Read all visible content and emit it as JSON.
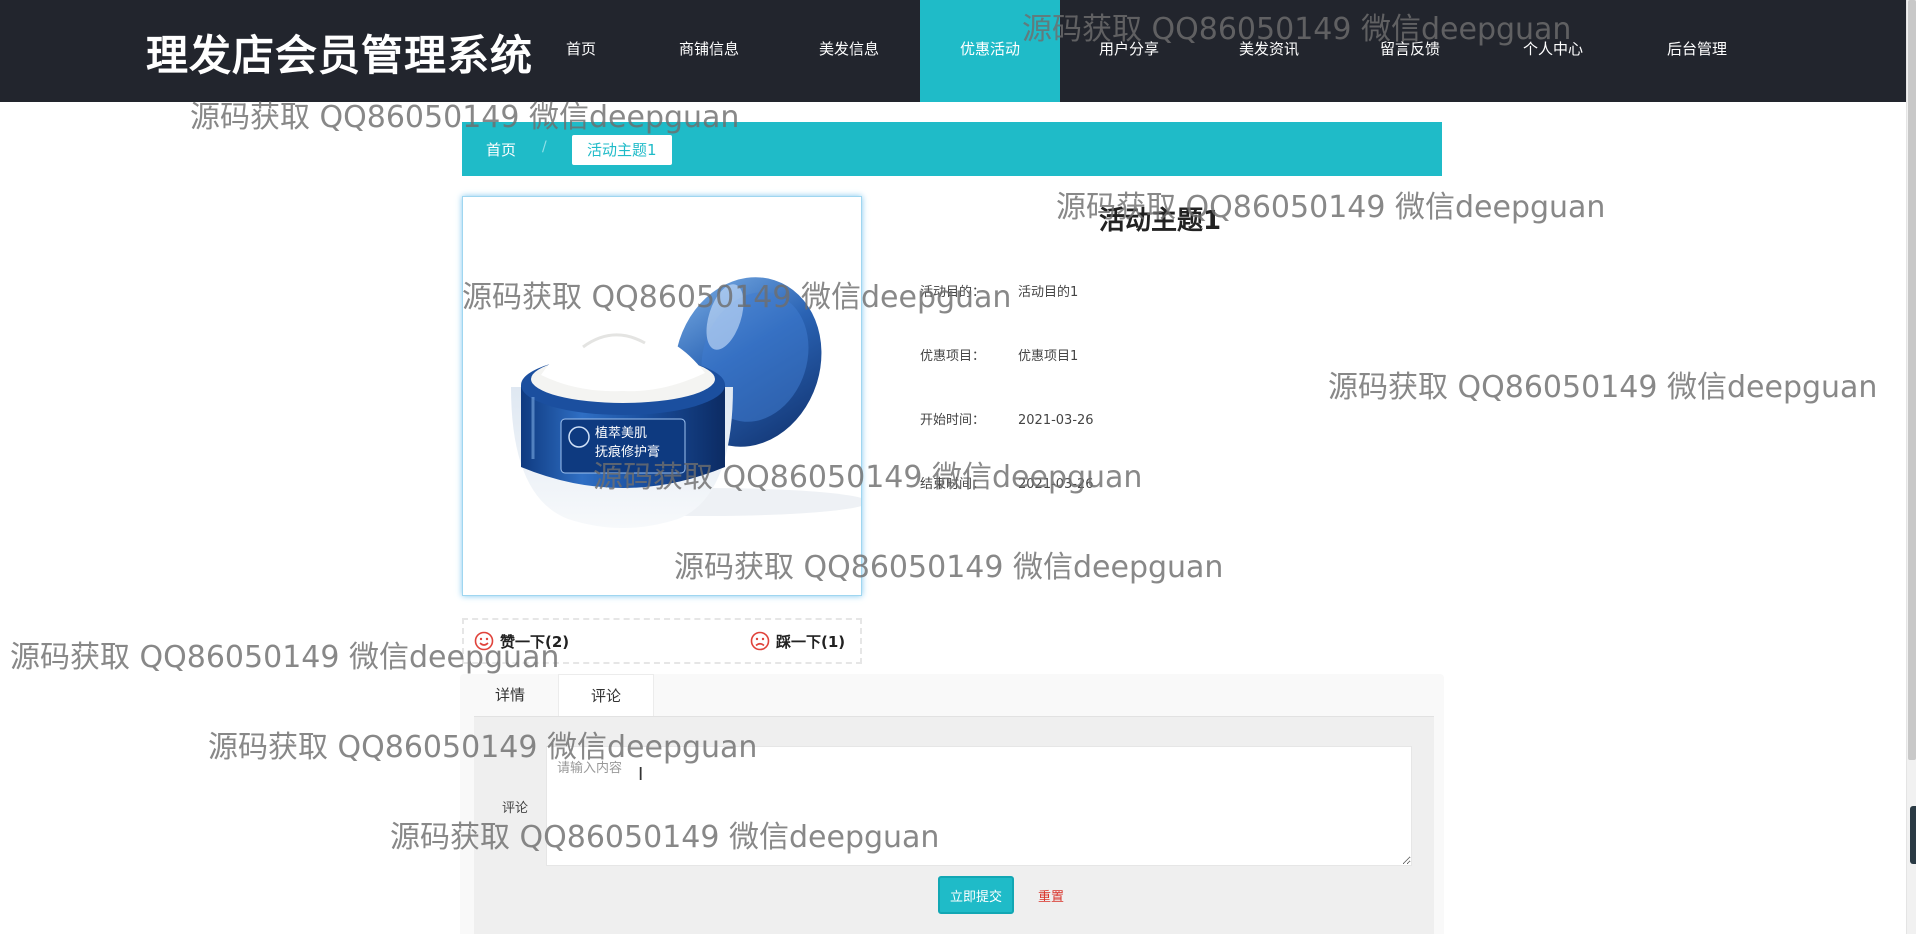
{
  "header": {
    "site_title": "理发店会员管理系统",
    "nav": [
      {
        "label": "首页"
      },
      {
        "label": "商铺信息"
      },
      {
        "label": "美发信息"
      },
      {
        "label": "优惠活动",
        "active": true
      },
      {
        "label": "用户分享"
      },
      {
        "label": "美发资讯"
      },
      {
        "label": "留言反馈"
      },
      {
        "label": "个人中心"
      },
      {
        "label": "后台管理"
      }
    ]
  },
  "breadcrumb": {
    "home": "首页",
    "separator": "/",
    "current": "活动主题1"
  },
  "product": {
    "jar_label_line1": "植萃美肌",
    "jar_label_line2": "抚痕修护膏"
  },
  "detail": {
    "title": "活动主题1",
    "rows": [
      {
        "label": "活动目的：",
        "value": "活动目的1"
      },
      {
        "label": "优惠项目：",
        "value": "优惠项目1"
      },
      {
        "label": "开始时间：",
        "value": "2021-03-26"
      },
      {
        "label": "结束时间：",
        "value": "2021-03-26"
      }
    ]
  },
  "votes": {
    "like": "赞一下(2)",
    "dislike": "踩一下(1)"
  },
  "tabs": [
    {
      "label": "详情"
    },
    {
      "label": "评论",
      "active": true
    }
  ],
  "comment": {
    "label": "评论",
    "placeholder": "请输入内容",
    "submit": "立即提交",
    "reset": "重置"
  },
  "watermark_text": "源码获取 QQ86050149 微信deepguan",
  "colors": {
    "header_bg": "#22252d",
    "accent": "#1fbbc8",
    "reset_text": "#d9342b"
  }
}
